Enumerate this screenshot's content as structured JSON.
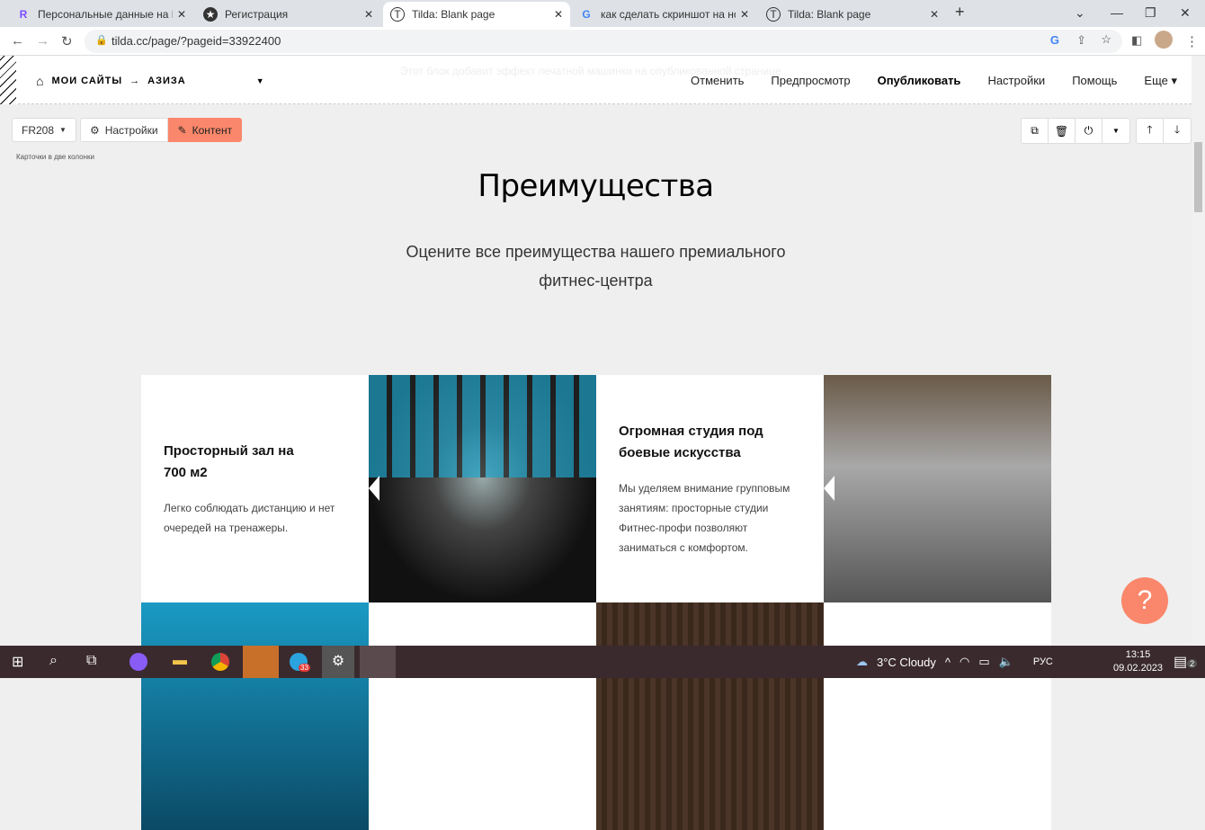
{
  "browser": {
    "tabs": [
      {
        "title": "Персональные данные на Freelance",
        "icon": "freelance-r-icon"
      },
      {
        "title": "Регистрация",
        "icon": "star-icon"
      },
      {
        "title": "Tilda: Blank page",
        "icon": "tilda-icon",
        "active": true
      },
      {
        "title": "как сделать скриншот на ноутбуке",
        "icon": "google-icon"
      },
      {
        "title": "Tilda: Blank page",
        "icon": "tilda-icon"
      }
    ],
    "url": "tilda.cc/page/?pageid=33922400"
  },
  "editor": {
    "breadcrumb": {
      "home": "МОИ САЙТЫ",
      "arrow": "→",
      "project": "АЗИЗА"
    },
    "ghost_text": "Этот блок добавит эффект печатной машинки на опубликованной странице",
    "menu": [
      "Отменить",
      "Предпросмотр",
      "Опубликовать",
      "Настройки",
      "Помощь",
      "Еще"
    ],
    "block_code": "FR208",
    "settings_label": "Настройки",
    "content_label": "Контент",
    "block_name": "Карточки в две колонки"
  },
  "page": {
    "title": "Преимущества",
    "subtitle": "Оцените все преимущества нашего премиального фитнес-центра",
    "cards": [
      {
        "title": "Просторный зал на 700 м2",
        "text": "Легко соблюдать дистанцию и нет очередей на тренажеры."
      },
      {
        "title": "Огромная студия под боевые искусства",
        "text": "Мы уделяем внимание групповым занятиям: просторные студии Фитнес-профи позволяют заниматься с комфортом."
      }
    ],
    "help": "?"
  },
  "taskbar": {
    "weather": "3°C  Cloudy",
    "lang": "РУС",
    "time": "13:15",
    "date": "09.02.2023",
    "telegram_badge": "33",
    "notifications": "2"
  },
  "colors": {
    "accent": "#fa876b"
  }
}
